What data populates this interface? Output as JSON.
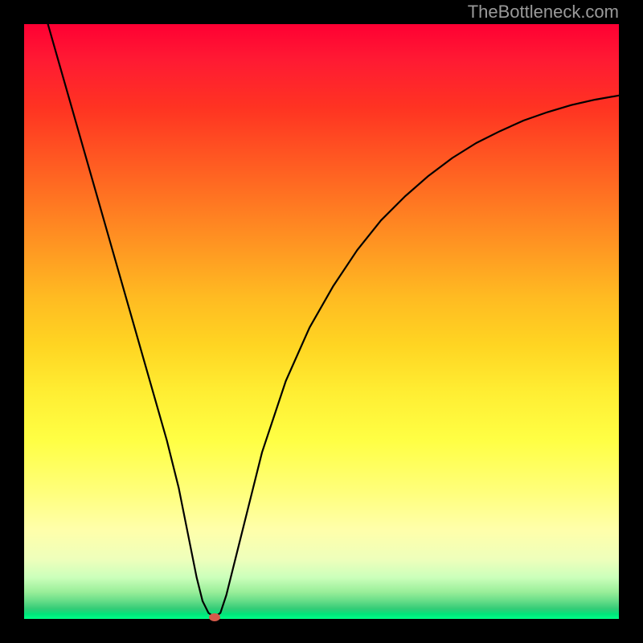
{
  "watermark": "TheBottleneck.com",
  "chart_data": {
    "type": "line",
    "title": "",
    "xlabel": "",
    "ylabel": "",
    "xlim": [
      0,
      100
    ],
    "ylim": [
      0,
      100
    ],
    "legend": false,
    "grid": false,
    "background": "rainbow-vertical-gradient",
    "series": [
      {
        "name": "bottleneck-curve",
        "color": "#000000",
        "x": [
          4,
          6,
          8,
          10,
          12,
          14,
          16,
          18,
          20,
          22,
          24,
          26,
          27,
          28,
          29,
          30,
          31,
          32,
          33,
          34,
          36,
          38,
          40,
          44,
          48,
          52,
          56,
          60,
          64,
          68,
          72,
          76,
          80,
          84,
          88,
          92,
          96,
          100
        ],
        "y": [
          100,
          93,
          86,
          79,
          72,
          65,
          58,
          51,
          44,
          37,
          30,
          22,
          17,
          12,
          7,
          3,
          1,
          0.3,
          1,
          4,
          12,
          20,
          28,
          40,
          49,
          56,
          62,
          67,
          71,
          74.5,
          77.5,
          80,
          82,
          83.8,
          85.2,
          86.4,
          87.3,
          88
        ]
      }
    ],
    "annotations": [
      {
        "type": "marker",
        "shape": "oval",
        "color": "#d65a4a",
        "x": 32,
        "y": 0.3,
        "label": "optimal-point"
      }
    ]
  }
}
